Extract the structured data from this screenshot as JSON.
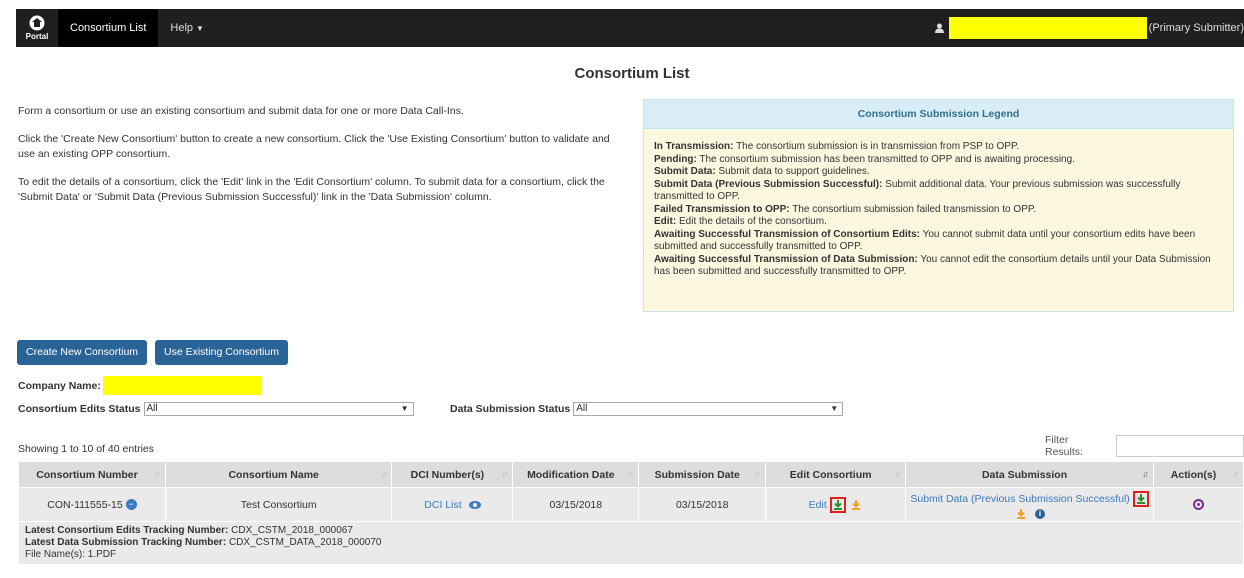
{
  "nav": {
    "logo_label": "Portal",
    "items": [
      "Consortium List",
      "Help"
    ],
    "user_role": "(Primary Submitter)"
  },
  "page_title": "Consortium List",
  "intro": [
    "Form a consortium or use an existing consortium and submit data for one or more Data Call-Ins.",
    "Click the 'Create New Consortium' button to create a new consortium. Click the 'Use Existing Consortium' button to validate and use an existing OPP consortium.",
    "To edit the details of a consortium, click the 'Edit' link in the 'Edit Consortium' column. To submit data for a consortium, click the 'Submit Data' or 'Submit Data (Previous Submission Successful)' link in the 'Data Submission' column."
  ],
  "legend": {
    "title": "Consortium Submission Legend",
    "entries": [
      {
        "term": "In Transmission:",
        "desc": " The consortium submission is in transmission from PSP to OPP."
      },
      {
        "term": "Pending:",
        "desc": " The consortium submission has been transmitted to OPP and is awaiting processing."
      },
      {
        "term": "Submit Data:",
        "desc": " Submit data to support guidelines."
      },
      {
        "term": "Submit Data (Previous Submission Successful):",
        "desc": " Submit additional data. Your previous submission was successfully transmitted to OPP."
      },
      {
        "term": "Failed Transmission to OPP:",
        "desc": " The consortium submission failed transmission to OPP."
      },
      {
        "term": "Edit:",
        "desc": " Edit the details of the consortium."
      },
      {
        "term": "Awaiting Successful Transmission of Consortium Edits:",
        "desc": " You cannot submit data until your consortium edits have been submitted and successfully transmitted to OPP."
      },
      {
        "term": "Awaiting Successful Transmission of Data Submission:",
        "desc": " You cannot edit the consortium details until your Data Submission has been submitted and successfully transmitted to OPP."
      }
    ]
  },
  "buttons": {
    "create": "Create New Consortium",
    "existing": "Use Existing Consortium"
  },
  "company_label": "Company Name:",
  "filters": {
    "edits_label": "Consortium Edits Status",
    "edits_value": "All",
    "data_label": "Data Submission Status",
    "data_value": "All"
  },
  "showing": "Showing 1 to 10 of 40 entries",
  "filter_results_label": "Filter Results:",
  "table": {
    "headers": [
      "Consortium Number",
      "Consortium Name",
      "DCI Number(s)",
      "Modification Date",
      "Submission Date",
      "Edit Consortium",
      "Data Submission",
      "Action(s)"
    ],
    "row": {
      "number": "CON-111555-15",
      "name": "Test Consortium",
      "dci": "DCI List",
      "mod_date": "03/15/2018",
      "sub_date": "03/15/2018",
      "edit": "Edit",
      "data_submission": "Submit Data (Previous Submission Successful)"
    },
    "details": {
      "edits_tracking_label": "Latest Consortium Edits Tracking Number:",
      "edits_tracking_value": " CDX_CSTM_2018_000067",
      "data_tracking_label": "Latest Data Submission Tracking Number:",
      "data_tracking_value": " CDX_CSTM_DATA_2018_000070",
      "files": "File Name(s): 1.PDF"
    }
  },
  "colors": {
    "navbar": "#1f1f1f",
    "button": "#2a6496",
    "legend_header": "#d9edf7",
    "legend_body": "#fcf8e0",
    "redaction": "#ffff00",
    "download_green": "#2e8b2e",
    "download_orange": "#f0a020"
  }
}
